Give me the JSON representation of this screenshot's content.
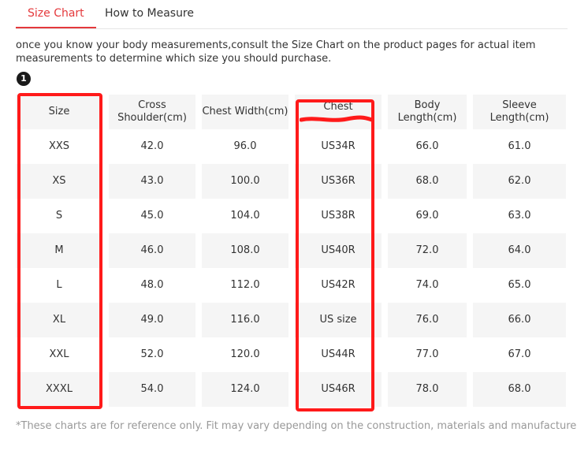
{
  "tabs": [
    {
      "label": "Size Chart",
      "active": true
    },
    {
      "label": "How to Measure",
      "active": false
    }
  ],
  "intro": "once you know your body measurements,consult the Size Chart on the product pages for actual item measurements to determine which size you should purchase.",
  "marker": "1",
  "table": {
    "headers": [
      "Size",
      "Cross Shoulder(cm)",
      "Chest Width(cm)",
      "Chest",
      "Body Length(cm)",
      "Sleeve Length(cm)"
    ],
    "rows": [
      [
        "XXS",
        "42.0",
        "96.0",
        "US34R",
        "66.0",
        "61.0"
      ],
      [
        "XS",
        "43.0",
        "100.0",
        "US36R",
        "68.0",
        "62.0"
      ],
      [
        "S",
        "45.0",
        "104.0",
        "US38R",
        "69.0",
        "63.0"
      ],
      [
        "M",
        "46.0",
        "108.0",
        "US40R",
        "72.0",
        "64.0"
      ],
      [
        "L",
        "48.0",
        "112.0",
        "US42R",
        "74.0",
        "65.0"
      ],
      [
        "XL",
        "49.0",
        "116.0",
        "US size",
        "76.0",
        "66.0"
      ],
      [
        "XXL",
        "52.0",
        "120.0",
        "US44R",
        "77.0",
        "67.0"
      ],
      [
        "XXXL",
        "54.0",
        "124.0",
        "US46R",
        "78.0",
        "68.0"
      ]
    ]
  },
  "footnote": "*These charts are for reference only. Fit may vary depending on the construction, materials and manufacturer.",
  "colors": {
    "accent": "#e4393c",
    "highlight": "#ff1a1a",
    "row_shade": "#f5f5f5"
  }
}
